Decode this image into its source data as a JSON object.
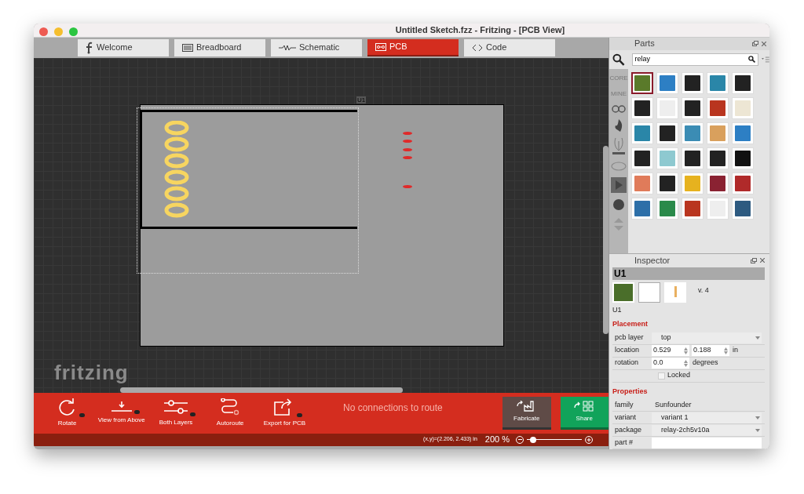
{
  "window": {
    "title": "Untitled Sketch.fzz - Fritzing - [PCB View]"
  },
  "tabs": [
    {
      "label": "Welcome",
      "kind": "welcome",
      "selected": false
    },
    {
      "label": "Breadboard",
      "kind": "breadboard",
      "selected": false
    },
    {
      "label": "Schematic",
      "kind": "schematic",
      "selected": false
    },
    {
      "label": "PCB",
      "kind": "pcb",
      "selected": true
    },
    {
      "label": "Code",
      "kind": "code",
      "selected": false
    }
  ],
  "canvas": {
    "part_label": "U1",
    "logo": "fritzing"
  },
  "toolbar": {
    "buttons": [
      {
        "label": "Rotate",
        "kind": "rotate",
        "menu": true
      },
      {
        "label": "View from Above",
        "kind": "view",
        "menu": true
      },
      {
        "label": "Both Layers",
        "kind": "layers",
        "menu": true
      },
      {
        "label": "Autoroute",
        "kind": "autoroute",
        "menu": false
      },
      {
        "label": "Export for PCB",
        "kind": "export",
        "menu": true
      }
    ],
    "message": "No connections to route",
    "fabricate": "Fabricate",
    "share": "Share"
  },
  "status_bar": {
    "coordinates": "(x,y)=(2.206, 2.433) in",
    "zoom": "200 %",
    "level": 0.12
  },
  "parts": {
    "title": "Parts",
    "search": "relay",
    "bins": [
      "CORE",
      "MINE"
    ],
    "thumbnails": [
      {
        "selected": true
      },
      {
        "selected": false
      },
      {
        "selected": false
      },
      {
        "selected": false
      },
      {
        "selected": false
      },
      {
        "selected": false
      },
      {
        "selected": false
      },
      {
        "selected": false
      },
      {
        "selected": false
      },
      {
        "selected": false
      },
      {
        "selected": false
      },
      {
        "selected": false
      },
      {
        "selected": false
      },
      {
        "selected": false
      },
      {
        "selected": false
      },
      {
        "selected": false
      },
      {
        "selected": false
      },
      {
        "selected": false
      },
      {
        "selected": false
      },
      {
        "selected": false
      },
      {
        "selected": false
      },
      {
        "selected": false
      },
      {
        "selected": false
      },
      {
        "selected": false
      },
      {
        "selected": false
      },
      {
        "selected": false
      },
      {
        "selected": false
      },
      {
        "selected": false
      },
      {
        "selected": false
      },
      {
        "selected": false
      }
    ]
  },
  "inspector": {
    "title": "Inspector",
    "part_title": "U1",
    "version": "v. 4",
    "caption": "U1",
    "placement": {
      "heading": "Placement",
      "rows": [
        {
          "label": "pcb layer",
          "kind": "select",
          "value": "top"
        },
        {
          "label": "location",
          "kind": "pair",
          "value": "0.529",
          "value2": "0.188",
          "unit": "in"
        },
        {
          "label": "rotation",
          "kind": "spin",
          "value": "0.0",
          "unit": "degrees"
        },
        {
          "label": "Locked",
          "kind": "checkbox",
          "checked": false
        }
      ]
    },
    "properties": {
      "heading": "Properties",
      "rows": [
        {
          "label": "family",
          "kind": "text",
          "value": "Sunfounder"
        },
        {
          "label": "variant",
          "kind": "select",
          "value": "variant 1"
        },
        {
          "label": "package",
          "kind": "select",
          "value": "relay-2ch5v10a"
        },
        {
          "label": "part #",
          "kind": "input",
          "value": ""
        }
      ]
    }
  }
}
